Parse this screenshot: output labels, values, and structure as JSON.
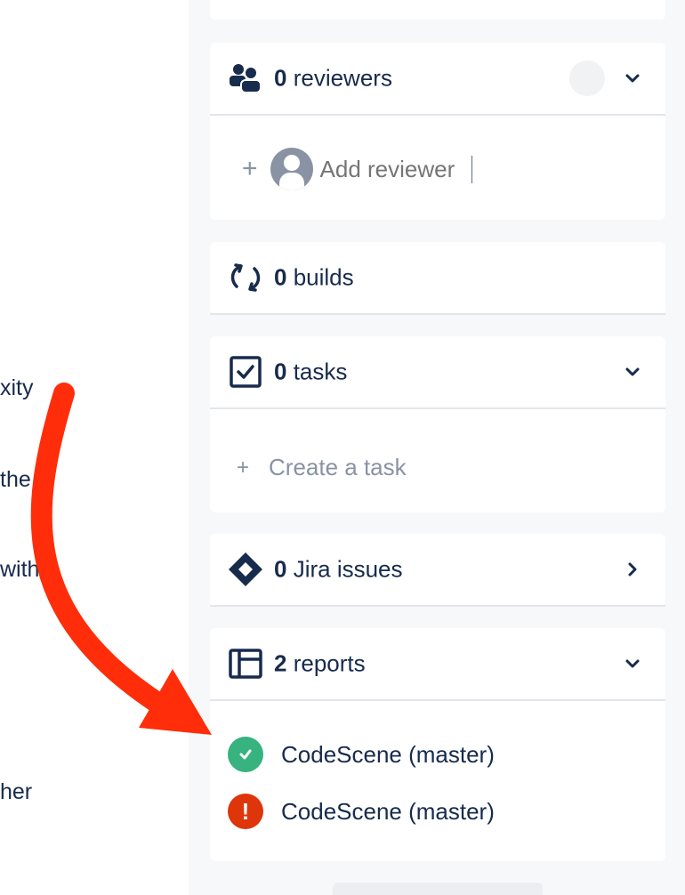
{
  "left_fragments": [
    "xity",
    "the",
    "with",
    "her"
  ],
  "reviewers": {
    "count": "0",
    "label": "reviewers",
    "add_placeholder": "Add reviewer",
    "icon": "users-icon"
  },
  "builds": {
    "count": "0",
    "label": "builds",
    "icon": "sync-icon"
  },
  "tasks": {
    "count": "0",
    "label": "tasks",
    "create_label": "Create a task",
    "icon": "checkbox-icon"
  },
  "jira": {
    "count": "0",
    "label": "Jira issues",
    "icon": "jira-icon"
  },
  "reports": {
    "count": "2",
    "label": "reports",
    "icon": "panel-icon",
    "items": [
      {
        "name": "CodeScene (master)",
        "status": "passed",
        "status_color": "#36b37e"
      },
      {
        "name": "CodeScene (master)",
        "status": "failed",
        "status_color": "#de350b",
        "status_glyph": "!"
      }
    ]
  },
  "colors": {
    "text": "#172b4d",
    "muted": "#8993a4",
    "accent_arrow": "#ff2d0a",
    "panel_bg": "#f7f8f9"
  }
}
